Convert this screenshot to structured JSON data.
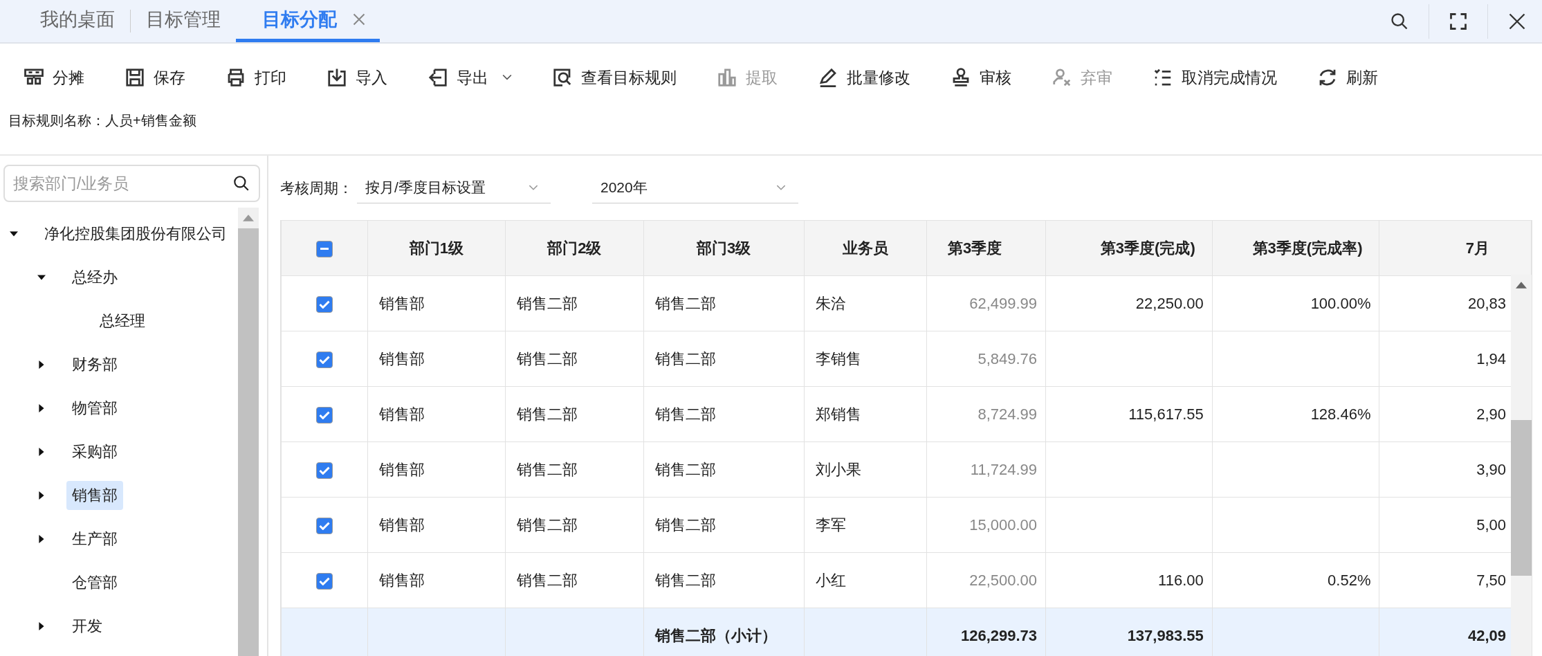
{
  "tabs": [
    {
      "label": "我的桌面",
      "selected": false,
      "closable": false
    },
    {
      "label": "目标管理",
      "selected": false,
      "closable": false
    },
    {
      "label": "目标分配",
      "selected": true,
      "closable": true
    }
  ],
  "toolbar": [
    {
      "label": "分摊",
      "disabled": false,
      "dropdown": false
    },
    {
      "label": "保存",
      "disabled": false,
      "dropdown": false
    },
    {
      "label": "打印",
      "disabled": false,
      "dropdown": false
    },
    {
      "label": "导入",
      "disabled": false,
      "dropdown": false
    },
    {
      "label": "导出",
      "disabled": false,
      "dropdown": true
    },
    {
      "label": "查看目标规则",
      "disabled": false,
      "dropdown": false
    },
    {
      "label": "提取",
      "disabled": true,
      "dropdown": false
    },
    {
      "label": "批量修改",
      "disabled": false,
      "dropdown": false
    },
    {
      "label": "审核",
      "disabled": false,
      "dropdown": false
    },
    {
      "label": "弃审",
      "disabled": true,
      "dropdown": false
    },
    {
      "label": "取消完成情况",
      "disabled": false,
      "dropdown": false
    },
    {
      "label": "刷新",
      "disabled": false,
      "dropdown": false
    }
  ],
  "rule_name": "目标规则名称：人员+销售金额",
  "sidebar": {
    "search": {
      "placeholder": "搜索部门/业务员"
    },
    "tree": [
      {
        "label": "净化控股集团股份有限公司",
        "kind": "folder",
        "expanded": true,
        "selected": false,
        "children": [
          {
            "label": "总经办",
            "kind": "folder",
            "expanded": true,
            "selected": false,
            "children": [
              {
                "label": "总经理",
                "kind": "leaf",
                "selected": false
              }
            ]
          },
          {
            "label": "财务部",
            "kind": "folder",
            "expanded": false,
            "selected": false
          },
          {
            "label": "物管部",
            "kind": "folder",
            "expanded": false,
            "selected": false
          },
          {
            "label": "采购部",
            "kind": "folder",
            "expanded": false,
            "selected": false
          },
          {
            "label": "销售部",
            "kind": "folder",
            "expanded": false,
            "selected": true
          },
          {
            "label": "生产部",
            "kind": "folder",
            "expanded": false,
            "selected": false
          },
          {
            "label": "仓管部",
            "kind": "leaf",
            "selected": false
          },
          {
            "label": "开发",
            "kind": "folder",
            "expanded": false,
            "selected": false
          }
        ]
      }
    ]
  },
  "filters": {
    "label": "考核周期：",
    "period": "按月/季度目标设置",
    "year": "2020年"
  },
  "table": {
    "select_all": {
      "partial": true
    },
    "columns": [
      {
        "label": "部门1级",
        "kind": "text",
        "readonly": false
      },
      {
        "label": "部门2级",
        "kind": "text",
        "readonly": false
      },
      {
        "label": "部门3级",
        "kind": "text",
        "readonly": false
      },
      {
        "label": "业务员",
        "kind": "text",
        "readonly": false
      },
      {
        "label": "第3季度",
        "kind": "number",
        "readonly": true
      },
      {
        "label": "第3季度(完成)",
        "kind": "number",
        "readonly": false
      },
      {
        "label": "第3季度(完成率)",
        "kind": "number",
        "readonly": false
      },
      {
        "label": "7月",
        "kind": "number",
        "readonly": false
      }
    ],
    "rows": [
      {
        "kind": "item",
        "checked": true,
        "cells": [
          "销售部",
          "销售二部",
          "销售二部",
          "朱洽",
          "62,499.99",
          "22,250.00",
          "100.00%",
          "20,83"
        ]
      },
      {
        "kind": "item",
        "checked": true,
        "cells": [
          "销售部",
          "销售二部",
          "销售二部",
          "李销售",
          "5,849.76",
          "",
          "",
          "1,94"
        ]
      },
      {
        "kind": "item",
        "checked": true,
        "cells": [
          "销售部",
          "销售二部",
          "销售二部",
          "郑销售",
          "8,724.99",
          "115,617.55",
          "128.46%",
          "2,90"
        ]
      },
      {
        "kind": "item",
        "checked": true,
        "cells": [
          "销售部",
          "销售二部",
          "销售二部",
          "刘小果",
          "11,724.99",
          "",
          "",
          "3,90"
        ]
      },
      {
        "kind": "item",
        "checked": true,
        "cells": [
          "销售部",
          "销售二部",
          "销售二部",
          "李军",
          "15,000.00",
          "",
          "",
          "5,00"
        ]
      },
      {
        "kind": "item",
        "checked": true,
        "cells": [
          "销售部",
          "销售二部",
          "销售二部",
          "小红",
          "22,500.00",
          "116.00",
          "0.52%",
          "7,50"
        ]
      },
      {
        "kind": "subtotal",
        "cells": [
          "",
          "",
          "销售二部（小计）",
          "",
          "126,299.73",
          "137,983.55",
          "",
          "42,09"
        ]
      }
    ]
  }
}
